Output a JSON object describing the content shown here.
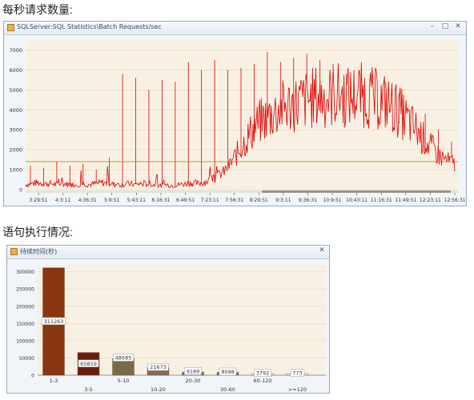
{
  "headings": {
    "requests_per_second": "每秒请求数量:",
    "statement_execution": "语句执行情况:"
  },
  "window1": {
    "title": "SQLServer:SQL Statistics\\Batch Requests/sec",
    "controls": {
      "minimize": "–",
      "maximize": "□",
      "close": "✕"
    }
  },
  "window2": {
    "title": "持续时间(秒)",
    "controls": {
      "close": "✕"
    }
  },
  "colors": {
    "plot_bg": "#f8f1e3",
    "line": "#e00000",
    "threshold": "#a88a3a",
    "bars": [
      "#8a3512",
      "#6e1c12",
      "#7a6a48",
      "#8a6a5a",
      "#6e6e6e",
      "#6e6e6e",
      "#f0d8c0",
      "#f5dcc8"
    ]
  },
  "chart_data": [
    {
      "type": "line",
      "title": "",
      "xlabel": "",
      "ylabel": "",
      "ylim": [
        0,
        7500
      ],
      "yticks": [
        0,
        1000,
        2000,
        3000,
        4000,
        5000,
        6000,
        7000
      ],
      "xtick_labels": [
        "3:29:51",
        "4:3:11",
        "4:36:31",
        "5:9:51",
        "5:43:11",
        "6:16:31",
        "6:49:51",
        "7:23:11",
        "7:56:31",
        "8:29:51",
        "9:3:11",
        "9:36:31",
        "10:9:51",
        "10:43:11",
        "11:16:31",
        "11:49:51",
        "12:23:11",
        "12:56:31"
      ],
      "threshold": 1400,
      "grid": true,
      "series": [
        {
          "values": [
            250,
            300,
            350,
            300,
            300,
            250,
            300,
            250,
            250,
            300,
            250,
            300,
            350,
            300,
            250,
            250,
            300,
            250,
            300,
            300,
            250,
            200,
            250,
            200,
            250,
            300,
            350,
            300,
            400,
            500,
            700,
            900,
            1300,
            1800,
            2300,
            2800,
            3200,
            3500,
            3700,
            3900,
            4100,
            4200,
            4300,
            4400,
            4500,
            4600,
            4700,
            4600,
            4700,
            4800,
            4600,
            4700,
            4800,
            4700,
            4600,
            4500,
            4400,
            4200,
            4000,
            3700,
            3300,
            3000,
            2600,
            2200,
            1900,
            1600,
            1400,
            1300
          ],
          "peaks": [
            1200,
            1100,
            1400,
            1200,
            1300,
            1000,
            1600,
            5800,
            5600,
            5000,
            5500,
            5400,
            6400,
            6000,
            6500,
            6000,
            6100,
            6300,
            6900,
            6400,
            6600,
            6800,
            6500,
            6300,
            5800,
            6000,
            5700,
            5400,
            4800,
            4200,
            3800,
            3000,
            2400
          ]
        }
      ]
    },
    {
      "type": "bar",
      "title": "",
      "xlabel": "",
      "ylabel": "",
      "ylim": [
        0,
        320000
      ],
      "yticks": [
        0,
        50000,
        100000,
        150000,
        200000,
        250000,
        300000
      ],
      "categories": [
        "1-3",
        "3-5",
        "5-10",
        "10-20",
        "20-30",
        "30-60",
        "60-120",
        ">=120"
      ],
      "values": [
        311263,
        65859,
        48685,
        21673,
        9189,
        8098,
        3792,
        773
      ],
      "value_labels": [
        "311263",
        "65859",
        "48685",
        "21673",
        "9189",
        "8098",
        "3792",
        "773"
      ],
      "grid": true
    }
  ]
}
